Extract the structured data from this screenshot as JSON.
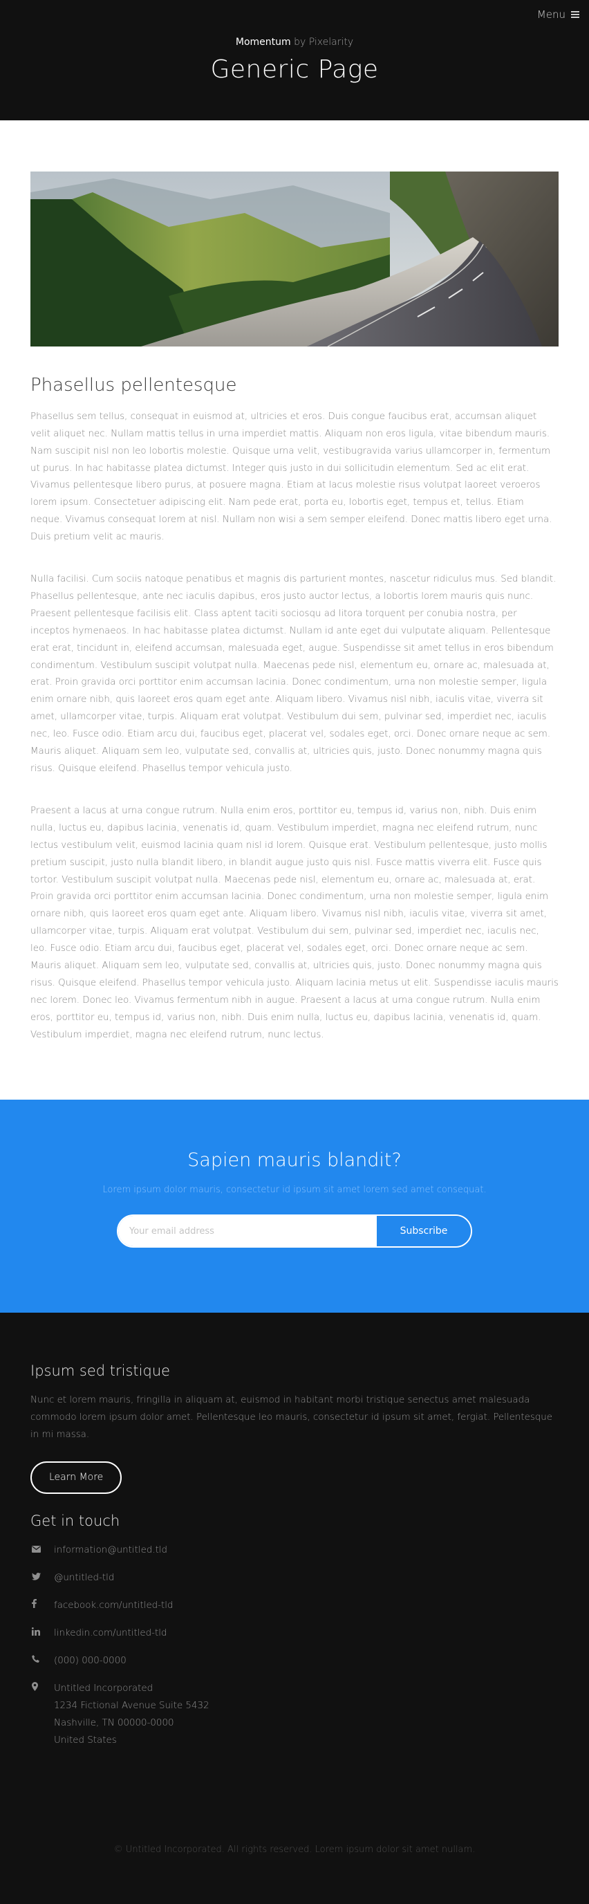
{
  "header": {
    "menu_label": "Menu",
    "brand_name": "Momentum",
    "brand_by": "by Pixelarity",
    "title": "Generic Page"
  },
  "main": {
    "title": "Phasellus pellentesque",
    "paragraphs": [
      "Phasellus sem tellus, consequat in euismod at, ultricies et eros. Duis congue faucibus erat, accumsan aliquet velit aliquet nec. Nullam mattis tellus in urna imperdiet mattis. Aliquam non eros ligula, vitae bibendum mauris. Nam suscipit nisl non leo lobortis molestie. Quisque urna velit, vestibugravida varius ullamcorper in, fermentum ut purus. In hac habitasse platea dictumst. Integer quis justo in dui sollicitudin elementum. Sed ac elit erat. Vivamus pellentesque libero purus, at posuere magna. Etiam at lacus molestie risus volutpat laoreet veroeros lorem ipsum. Consectetuer adipiscing elit. Nam pede erat, porta eu, lobortis eget, tempus et, tellus. Etiam neque. Vivamus consequat lorem at nisl. Nullam non wisi a sem semper eleifend. Donec mattis libero eget urna. Duis pretium velit ac mauris.",
      "Nulla facilisi. Cum sociis natoque penatibus et magnis dis parturient montes, nascetur ridiculus mus. Sed blandit. Phasellus pellentesque, ante nec iaculis dapibus, eros justo auctor lectus, a lobortis lorem mauris quis nunc. Praesent pellentesque facilisis elit. Class aptent taciti sociosqu ad litora torquent per conubia nostra, per inceptos hymenaeos. In hac habitasse platea dictumst. Nullam id ante eget dui vulputate aliquam. Pellentesque erat erat, tincidunt in, eleifend accumsan, malesuada eget, augue. Suspendisse sit amet tellus in eros bibendum condimentum. Vestibulum suscipit volutpat nulla. Maecenas pede nisl, elementum eu, ornare ac, malesuada at, erat. Proin gravida orci porttitor enim accumsan lacinia. Donec condimentum, urna non molestie semper, ligula enim ornare nibh, quis laoreet eros quam eget ante. Aliquam libero. Vivamus nisl nibh, iaculis vitae, viverra sit amet, ullamcorper vitae, turpis. Aliquam erat volutpat. Vestibulum dui sem, pulvinar sed, imperdiet nec, iaculis nec, leo. Fusce odio. Etiam arcu dui, faucibus eget, placerat vel, sodales eget, orci. Donec ornare neque ac sem. Mauris aliquet. Aliquam sem leo, vulputate sed, convallis at, ultricies quis, justo. Donec nonummy magna quis risus. Quisque eleifend. Phasellus tempor vehicula justo.",
      "Praesent a lacus at urna congue rutrum. Nulla enim eros, porttitor eu, tempus id, varius non, nibh. Duis enim nulla, luctus eu, dapibus lacinia, venenatis id, quam. Vestibulum imperdiet, magna nec eleifend rutrum, nunc lectus vestibulum velit, euismod lacinia quam nisl id lorem. Quisque erat. Vestibulum pellentesque, justo mollis pretium suscipit, justo nulla blandit libero, in blandit augue justo quis nisl. Fusce mattis viverra elit. Fusce quis tortor. Vestibulum suscipit volutpat nulla. Maecenas pede nisl, elementum eu, ornare ac, malesuada at, erat. Proin gravida orci porttitor enim accumsan lacinia. Donec condimentum, urna non molestie semper, ligula enim ornare nibh, quis laoreet eros quam eget ante. Aliquam libero. Vivamus nisl nibh, iaculis vitae, viverra sit amet, ullamcorper vitae, turpis. Aliquam erat volutpat. Vestibulum dui sem, pulvinar sed, imperdiet nec, iaculis nec, leo. Fusce odio. Etiam arcu dui, faucibus eget, placerat vel, sodales eget, orci. Donec ornare neque ac sem. Mauris aliquet. Aliquam sem leo, vulputate sed, convallis at, ultricies quis, justo. Donec nonummy magna quis risus. Quisque eleifend. Phasellus tempor vehicula justo. Aliquam lacinia metus ut elit. Suspendisse iaculis mauris nec lorem. Donec leo. Vivamus fermentum nibh in augue. Praesent a lacus at urna congue rutrum. Nulla enim eros, porttitor eu, tempus id, varius non, nibh. Duis enim nulla, luctus eu, dapibus lacinia, venenatis id, quam. Vestibulum imperdiet, magna nec eleifend rutrum, nunc lectus."
    ]
  },
  "subscribe": {
    "title": "Sapien mauris blandit?",
    "text": "Lorem ipsum dolor mauris, consectetur id ipsum sit amet lorem sed amet consequat.",
    "email_placeholder": "Your email address",
    "button_label": "Subscribe",
    "accent_color": "#2288ee"
  },
  "footer": {
    "title": "Ipsum sed tristique",
    "text": "Nunc et lorem mauris, fringilla in aliquam at, euismod in habitant morbi tristique senectus amet malesuada commodo lorem ipsum dolor amet. Pellentesque leo mauris, consectetur id ipsum sit amet, fergiat. Pellentesque in mi massa.",
    "learn_more_label": "Learn More",
    "contact_title": "Get in touch",
    "contacts": [
      {
        "icon": "envelope-icon",
        "text": "information@untitled.tld"
      },
      {
        "icon": "twitter-icon",
        "text": "@untitled-tld"
      },
      {
        "icon": "facebook-icon",
        "text": "facebook.com/untitled-tld"
      },
      {
        "icon": "linkedin-icon",
        "text": "linkedin.com/untitled-tld"
      },
      {
        "icon": "phone-icon",
        "text": "(000) 000-0000"
      }
    ],
    "address": {
      "icon": "map-marker-icon",
      "lines": [
        "Untitled Incorporated",
        "1234 Fictional Avenue Suite 5432",
        "Nashville, TN 00000-0000",
        "United States"
      ]
    },
    "copyright": "© Untitled Incorporated. All rights reserved. Lorem ipsum dolor sit amet nullam."
  }
}
